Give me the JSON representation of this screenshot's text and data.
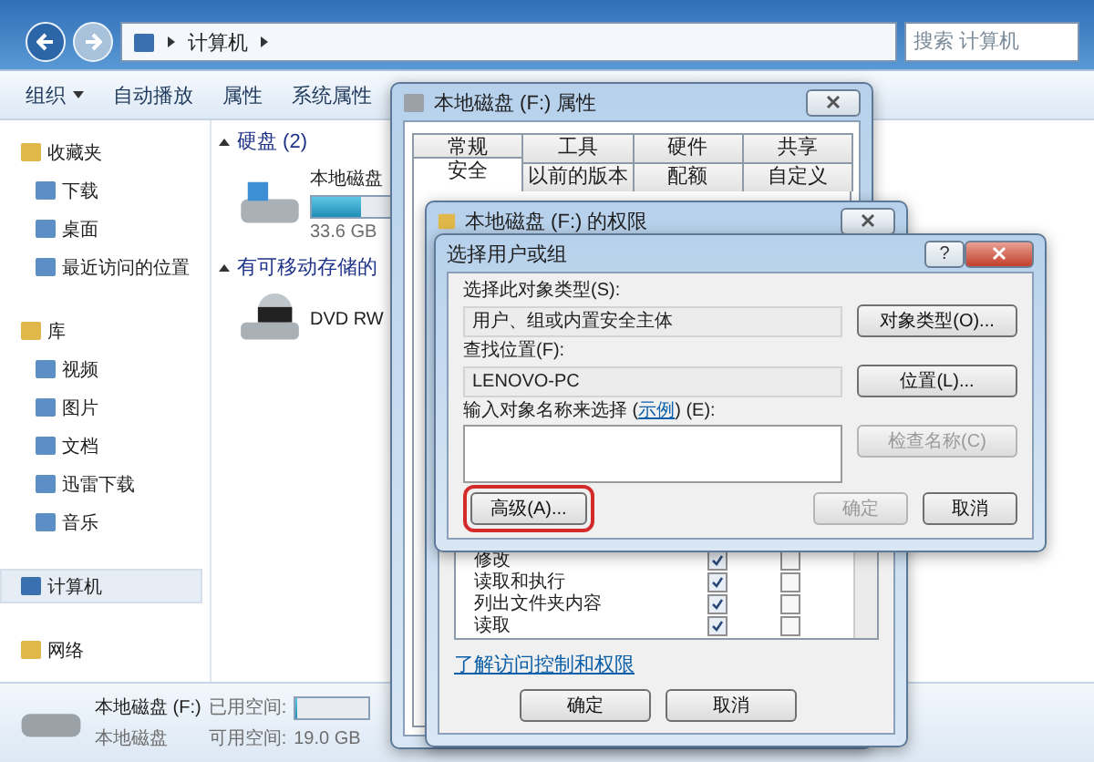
{
  "explorer": {
    "breadcrumb": "计算机",
    "search": {
      "placeholder": "搜索 计算机"
    },
    "toolbar": [
      {
        "label": "组织",
        "dropdown": true
      },
      {
        "label": "自动播放",
        "dropdown": false
      },
      {
        "label": "属性",
        "dropdown": false
      },
      {
        "label": "系统属性",
        "dropdown": false
      }
    ],
    "sidebar": [
      {
        "label": "收藏夹",
        "selected": false,
        "children": [
          {
            "label": "下载",
            "selected": false
          },
          {
            "label": "桌面",
            "selected": false
          },
          {
            "label": "最近访问的位置",
            "selected": false
          }
        ]
      },
      {
        "label": "库",
        "selected": false,
        "children": [
          {
            "label": "视频",
            "selected": false
          },
          {
            "label": "图片",
            "selected": false
          },
          {
            "label": "文档",
            "selected": false
          },
          {
            "label": "迅雷下载",
            "selected": false
          },
          {
            "label": "音乐",
            "selected": false
          }
        ]
      },
      {
        "label": "计算机",
        "selected": true
      },
      {
        "label": "网络",
        "selected": false
      }
    ],
    "sections": [
      {
        "title": "硬盘 (2)",
        "expanded": true,
        "items": [
          {
            "kind": "disk",
            "name": "本地磁盘",
            "detail": "33.6 GB",
            "level": 0.45
          }
        ]
      },
      {
        "title": "有可移动存储的",
        "expanded": true,
        "items": [
          {
            "kind": "dvd",
            "name": "DVD RW"
          }
        ]
      }
    ],
    "status": {
      "name": "本地磁盘 (F:)",
      "type": "本地磁盘",
      "used_label": "已用空间:",
      "free_label": "可用空间:",
      "free": "19.0 GB",
      "level": 0.02
    }
  },
  "properties": {
    "title": "本地磁盘 (F:) 属性",
    "tab_rows": [
      [
        {
          "label": "常规",
          "selected": false
        },
        {
          "label": "工具",
          "selected": false
        },
        {
          "label": "硬件",
          "selected": false
        },
        {
          "label": "共享",
          "selected": false
        }
      ],
      [
        {
          "label": "安全",
          "selected": true
        },
        {
          "label": "以前的版本",
          "selected": false
        },
        {
          "label": "配额",
          "selected": false
        },
        {
          "label": "自定义",
          "selected": false
        }
      ]
    ]
  },
  "permissions": {
    "title": "本地磁盘 (F:) 的权限",
    "rows": [
      {
        "name": "修改",
        "allow": true,
        "deny": false
      },
      {
        "name": "读取和执行",
        "allow": true,
        "deny": false
      },
      {
        "name": "列出文件夹内容",
        "allow": true,
        "deny": false
      },
      {
        "name": "读取",
        "allow": true,
        "deny": false
      }
    ],
    "link": "了解访问控制和权限",
    "buttons": [
      {
        "label": "确定",
        "disabled": false
      },
      {
        "label": "取消",
        "disabled": false
      }
    ]
  },
  "select_dialog": {
    "title": "选择用户或组",
    "help_button": "?",
    "type_label": "选择此对象类型(S):",
    "type_value": "用户、组或内置安全主体",
    "type_button": "对象类型(O)...",
    "location_label": "查找位置(F):",
    "location_value": "LENOVO-PC",
    "location_button": "位置(L)...",
    "names_label_before": "输入对象名称来选择 (",
    "names_link": "示例",
    "names_label_after": ") (E):",
    "check_button": {
      "label": "检查名称(C)",
      "disabled": true
    },
    "advanced_button": {
      "label": "高级(A)...",
      "highlighted": true
    },
    "ok_button": {
      "label": "确定",
      "disabled": true
    },
    "cancel_button": {
      "label": "取消",
      "disabled": false
    }
  }
}
